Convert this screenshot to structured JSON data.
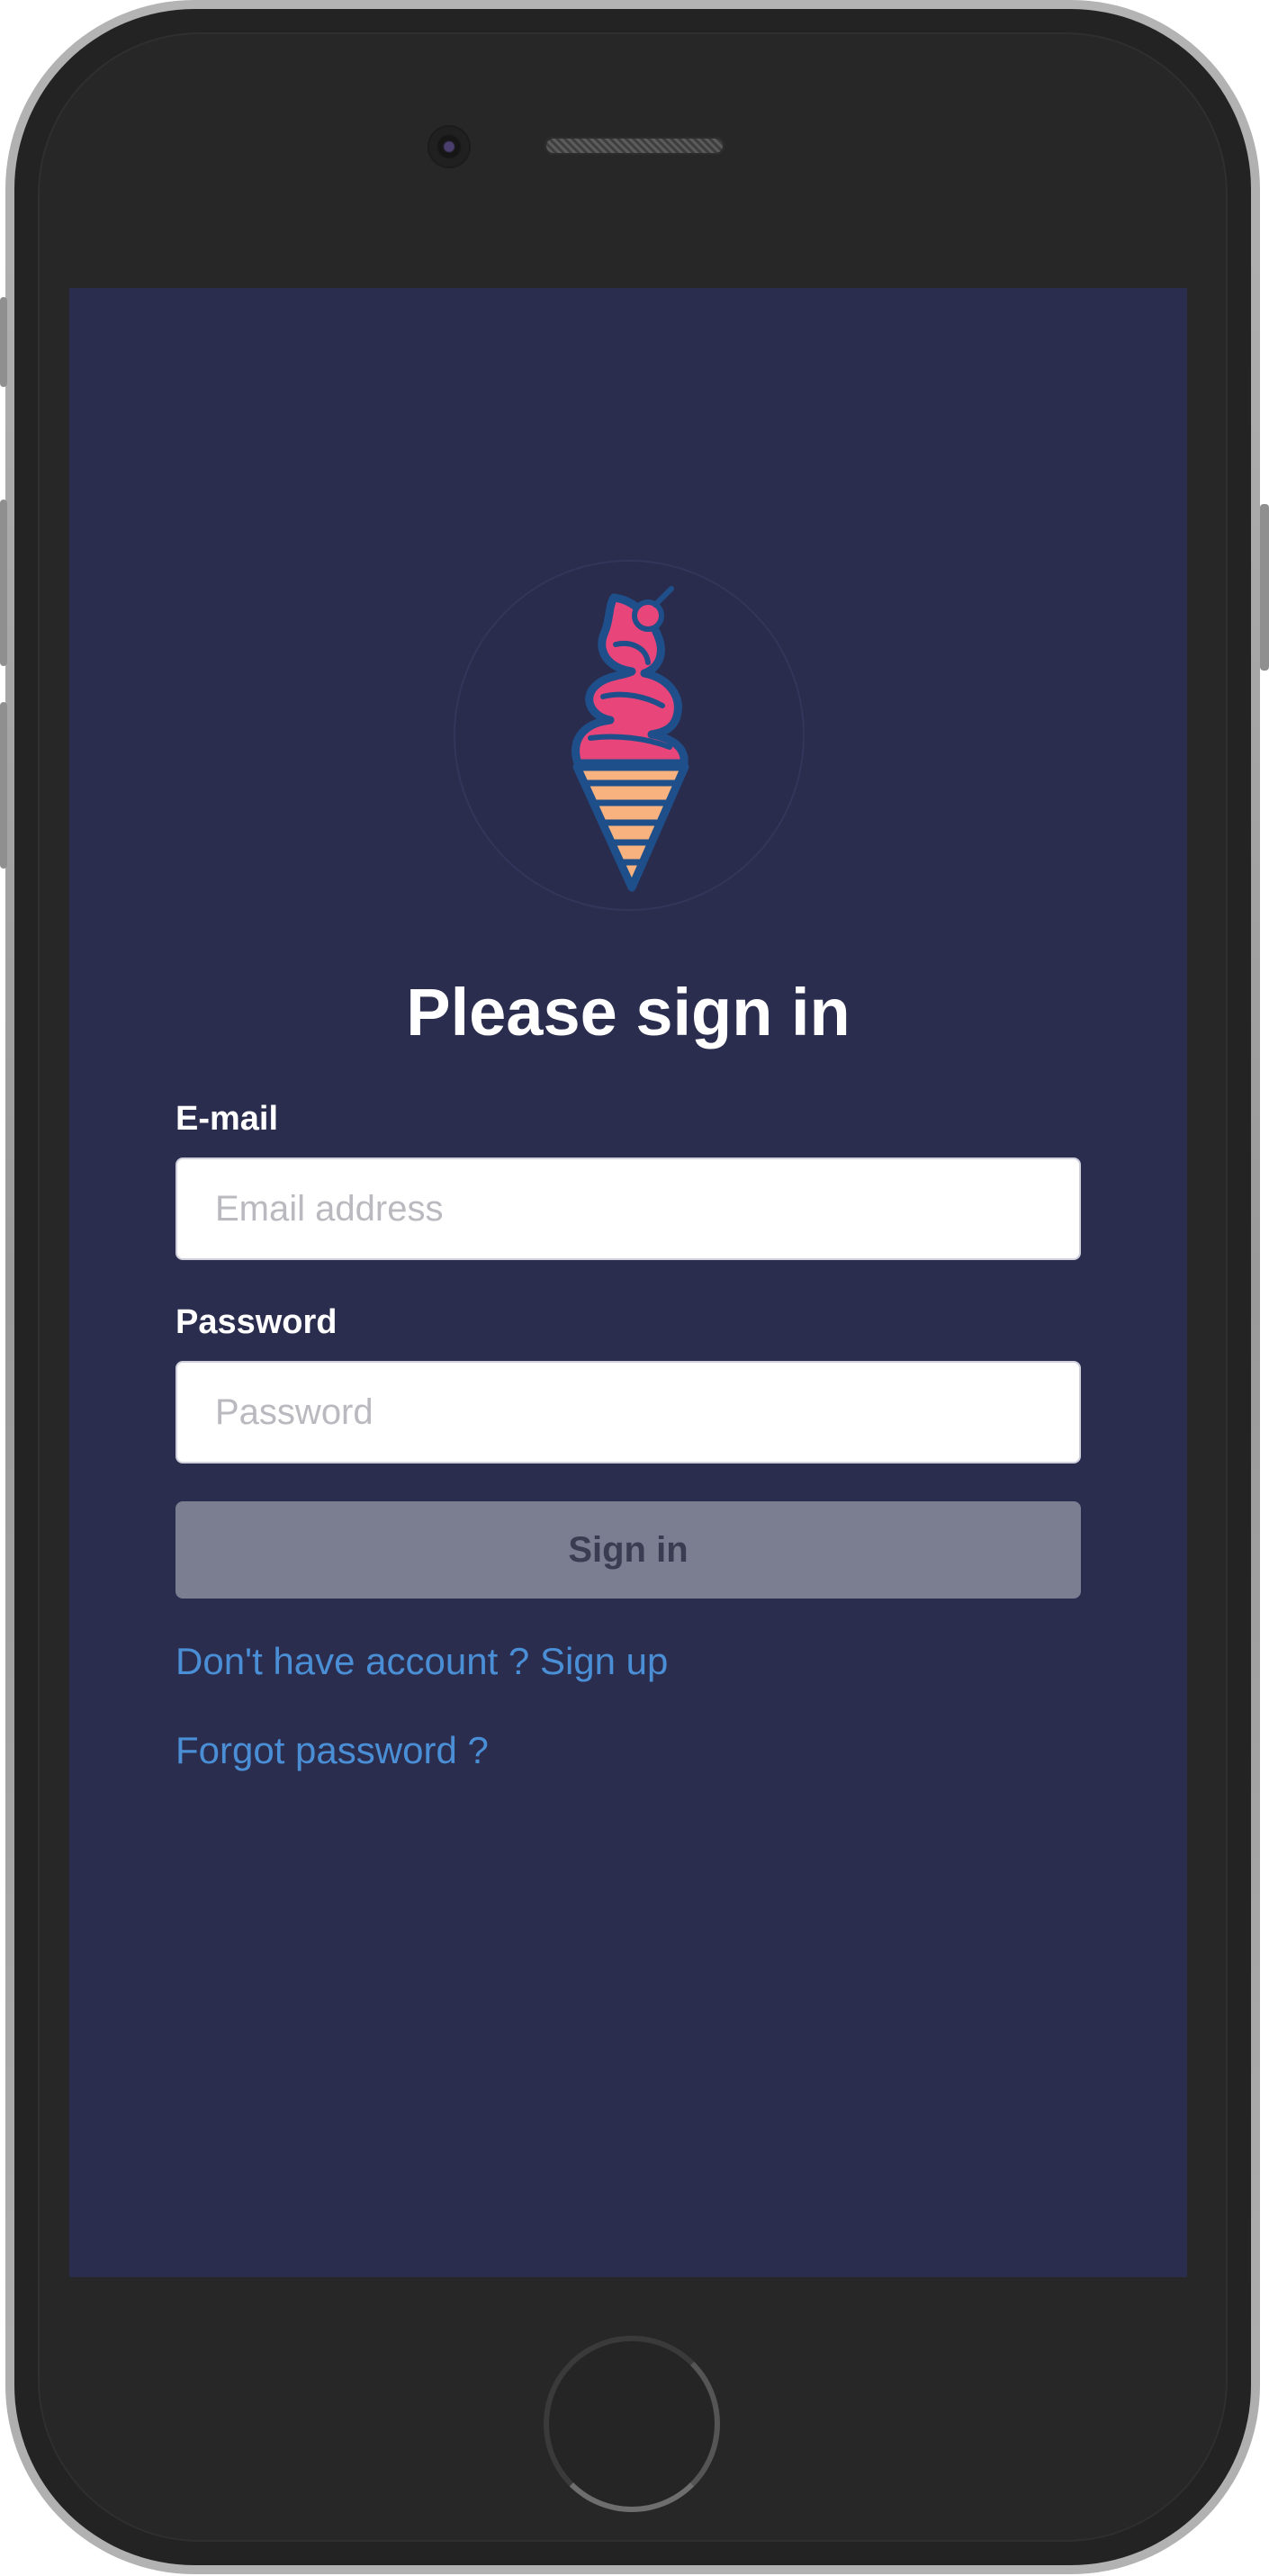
{
  "login": {
    "title": "Please sign in",
    "email": {
      "label": "E-mail",
      "placeholder": "Email address",
      "value": ""
    },
    "password": {
      "label": "Password",
      "placeholder": "Password",
      "value": ""
    },
    "signin_button": "Sign in",
    "signup_link": "Don't have account ? Sign up",
    "forgot_link": "Forgot password ?"
  },
  "icons": {
    "logo": "ice-cream-cone-icon"
  },
  "colors": {
    "screen_background": "#2b2d4f",
    "button_background": "#7b7d91",
    "button_text": "#3a3c52",
    "link": "#4a8fd6",
    "logo_cream": "#e8457a",
    "logo_cone": "#f7b27f",
    "logo_outline": "#1f4f8a",
    "device_frame": "#232323"
  }
}
